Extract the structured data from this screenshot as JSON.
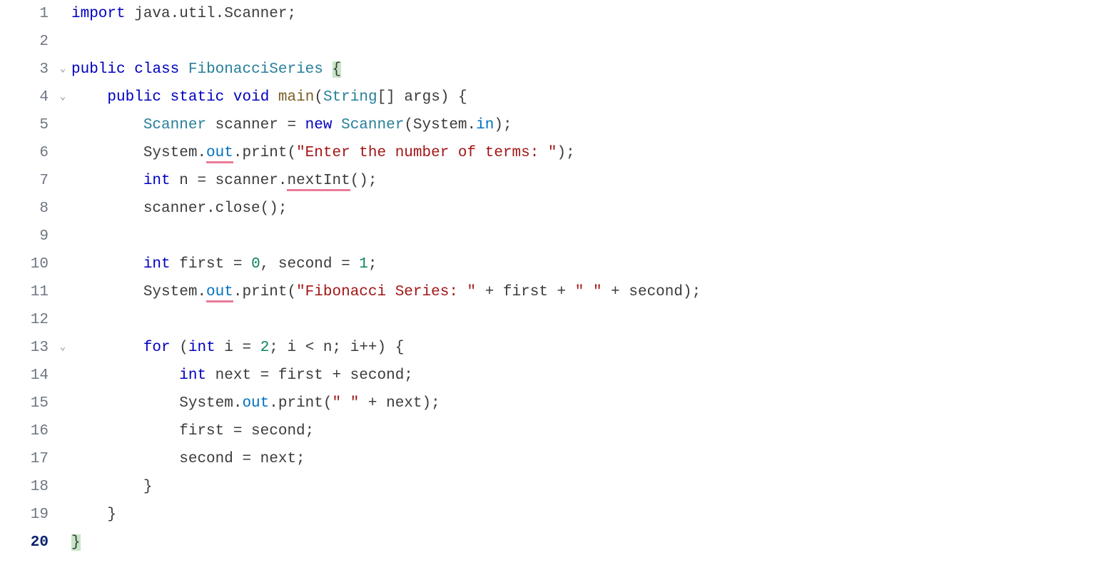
{
  "gutter": {
    "n1": "1",
    "n2": "2",
    "n3": "3",
    "n4": "4",
    "n5": "5",
    "n6": "6",
    "n7": "7",
    "n8": "8",
    "n9": "9",
    "n10": "10",
    "n11": "11",
    "n12": "12",
    "n13": "13",
    "n14": "14",
    "n15": "15",
    "n16": "16",
    "n17": "17",
    "n18": "18",
    "n19": "19",
    "n20": "20"
  },
  "fold": {
    "down": "⌄"
  },
  "code": {
    "l1": {
      "import": "import",
      "pkg": " java.util.Scanner",
      "semi": ";"
    },
    "l3": {
      "public": "public",
      "class": "class",
      "name": "FibonacciSeries",
      "ob": "{"
    },
    "l4": {
      "public": "public",
      "static": "static",
      "void": "void",
      "main": "main",
      "op": "(",
      "string": "String",
      "brk": "[] ",
      "args": "args",
      "cp": ") {"
    },
    "l5": {
      "type1": "Scanner",
      "var": " scanner = ",
      "new": "new",
      "type2": "Scanner",
      "op": "(System.",
      "in": "in",
      "cp": ");"
    },
    "l6": {
      "pre": "System.",
      "out": "out",
      "mid": ".print(",
      "str": "\"Enter the number of terms: \"",
      "post": ");"
    },
    "l7": {
      "int": "int",
      "mid": " n = scanner.",
      "ni": "nextInt",
      "post": "();"
    },
    "l8": {
      "all": "scanner.close();"
    },
    "l10": {
      "int": "int",
      "a": " first = ",
      "z": "0",
      "b": ", second = ",
      "o": "1",
      "c": ";"
    },
    "l11": {
      "pre": "System.",
      "out": "out",
      "mid": ".print(",
      "s1": "\"Fibonacci Series: \"",
      "a": " + first + ",
      "s2": "\" \"",
      "b": " + second);"
    },
    "l13": {
      "for": "for",
      "a": " (",
      "int": "int",
      "b": " i = ",
      "two": "2",
      "c": "; i < n; i++) {"
    },
    "l14": {
      "int": "int",
      "rest": " next = first + second;"
    },
    "l15": {
      "pre": "System.",
      "out": "out",
      "mid": ".print(",
      "s": "\" \"",
      "post": " + next);"
    },
    "l16": {
      "all": "first = second;"
    },
    "l17": {
      "all": "second = next;"
    },
    "l18": {
      "all": "}"
    },
    "l19": {
      "all": "}"
    },
    "l20": {
      "all": "}"
    }
  }
}
